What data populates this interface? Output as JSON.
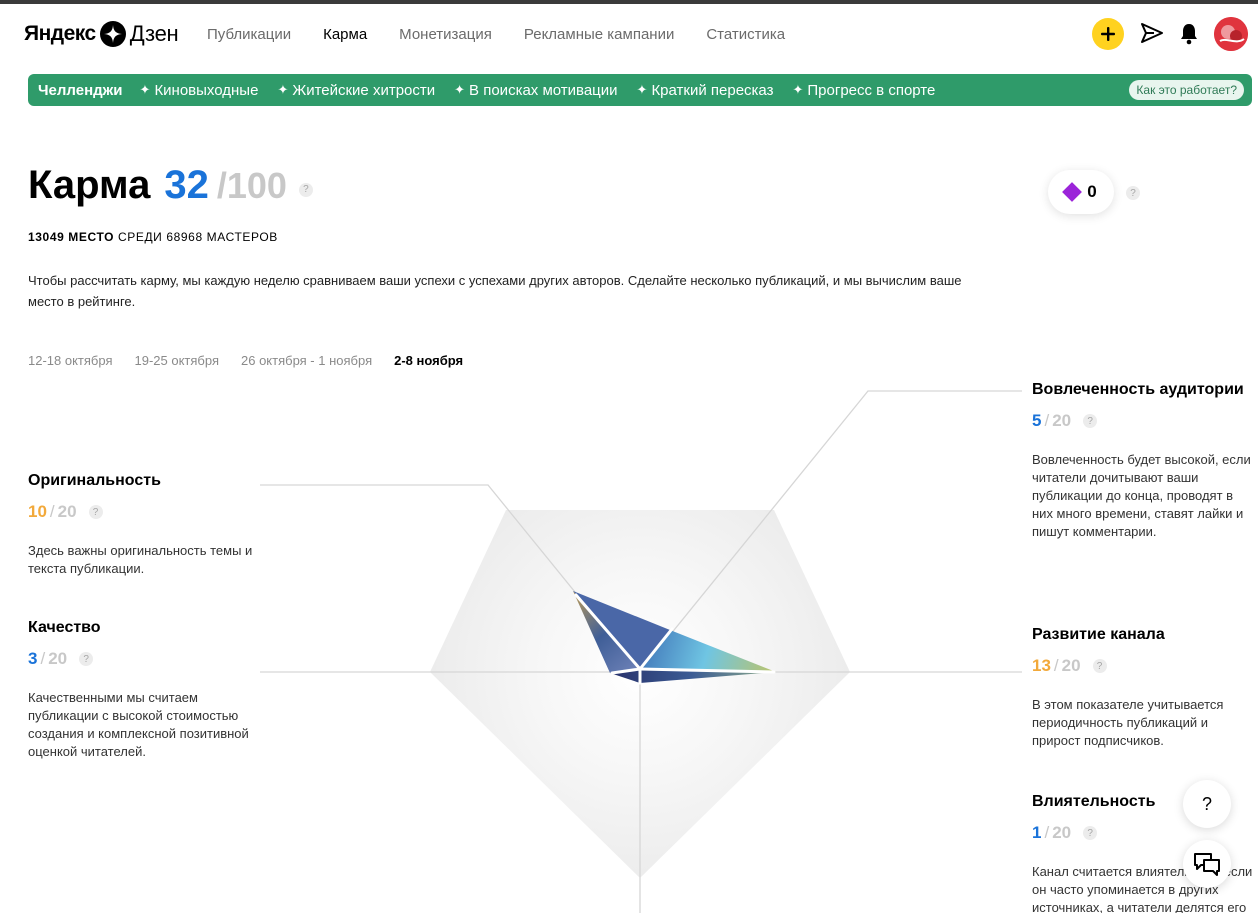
{
  "header": {
    "logo_yandex": "Яндекс",
    "logo_zen": "Дзен",
    "nav": [
      {
        "label": "Публикации",
        "active": false
      },
      {
        "label": "Карма",
        "active": true
      },
      {
        "label": "Монетизация",
        "active": false
      },
      {
        "label": "Рекламные кампании",
        "active": false
      },
      {
        "label": "Статистика",
        "active": false
      }
    ],
    "icons": [
      "plus-icon",
      "send-icon",
      "bell-icon",
      "avatar"
    ]
  },
  "challenges": {
    "title": "Челленджи",
    "items": [
      "Киновыходные",
      "Житейские хитрости",
      "В поисках мотивации",
      "Краткий пересказ",
      "Прогресс в спорте"
    ],
    "how_it_works": "Как это работает?",
    "star_glyph": "✦",
    "bg_color": "#2f9b6a"
  },
  "karma": {
    "title": "Карма",
    "value": "32",
    "max": "/100",
    "rank_place": "13049 МЕСТО",
    "rank_rest": "СРЕДИ 68968 МАСТЕРОВ",
    "description": "Чтобы рассчитать карму, мы каждую неделю сравниваем ваши успехи с успехами других авторов. Сделайте несколько публикаций, и мы вычислим ваше место в рейтинге.",
    "diamonds": "0",
    "help": "?"
  },
  "weeks": [
    {
      "label": "12-18 октября",
      "active": false
    },
    {
      "label": "19-25 октября",
      "active": false
    },
    {
      "label": "26 октября - 1 ноября",
      "active": false
    },
    {
      "label": "2-8 ноября",
      "active": true
    }
  ],
  "metrics": {
    "originality": {
      "title": "Оригинальность",
      "value": "10",
      "sep": "/",
      "max": "20",
      "description": "Здесь важны оригинальность темы и текста публикации.",
      "color": "#f2a93b"
    },
    "quality": {
      "title": "Качество",
      "value": "3",
      "sep": "/",
      "max": "20",
      "description": "Качественными мы считаем публикации с высокой стоимостью создания и комплексной позитивной оценкой читателей.",
      "color": "#1a73d9"
    },
    "engagement": {
      "title": "Вовлеченность аудитории",
      "value": "5",
      "sep": "/",
      "max": "20",
      "description": "Вовлеченность будет высокой, если читатели дочитывают ваши публикации до конца, проводят в них много времени, ставят лайки и пишут комментарии.",
      "color": "#1a73d9"
    },
    "growth": {
      "title": "Развитие канала",
      "value": "13",
      "sep": "/",
      "max": "20",
      "description": "В этом показателе учитывается периодичность публикаций и прирост подписчиков.",
      "color": "#f2a93b"
    },
    "influence": {
      "title": "Влиятельность",
      "value": "1",
      "sep": "/",
      "max": "20",
      "description": "Канал считается влиятельным, если он часто упоминается в других источниках, а читатели делятся его",
      "color": "#1a73d9"
    }
  },
  "fabs": {
    "help": "?",
    "chat_icon": "chat-icon"
  }
}
